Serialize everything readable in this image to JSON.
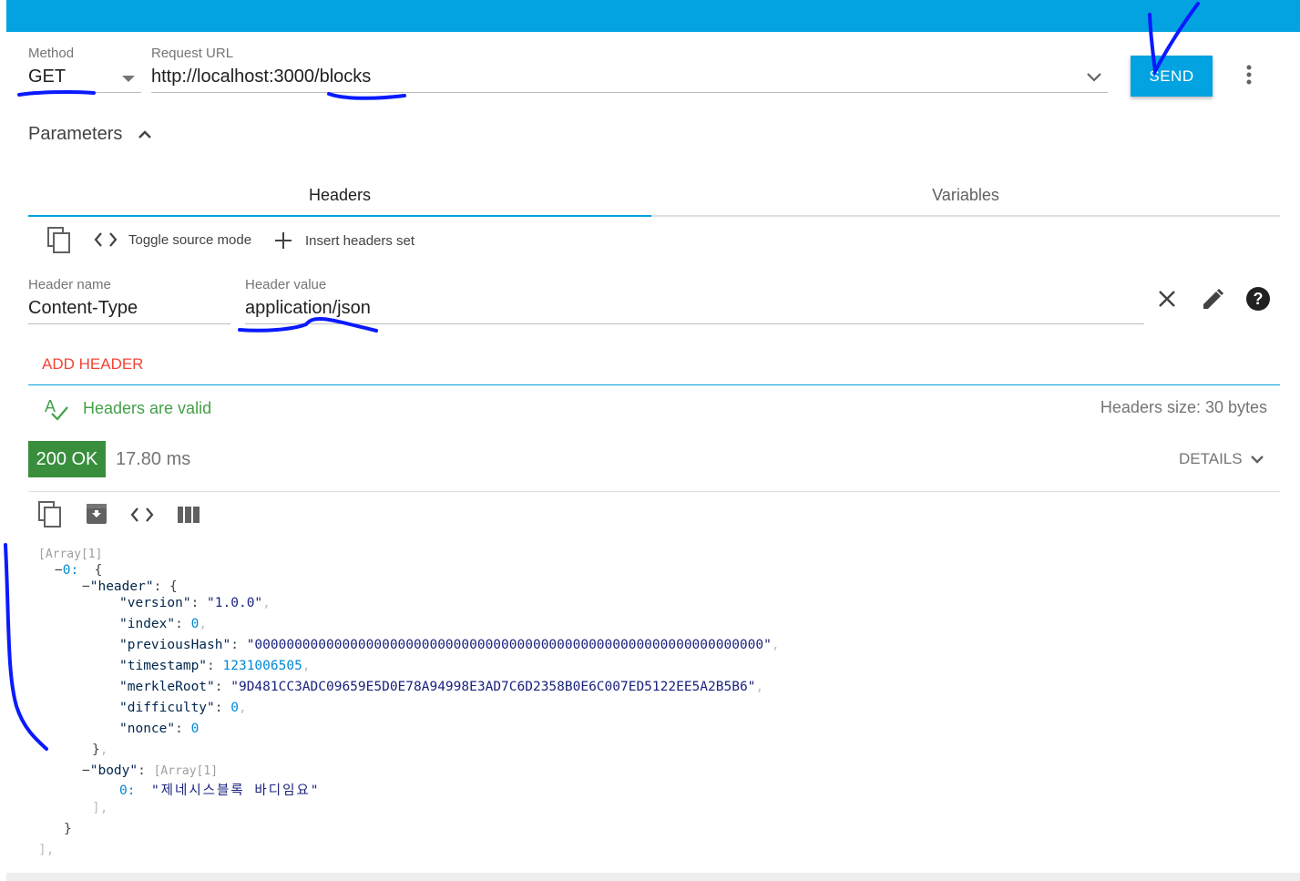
{
  "request": {
    "method_label": "Method",
    "method_value": "GET",
    "url_label": "Request URL",
    "url_value": "http://localhost:3000/blocks",
    "send_label": "SEND"
  },
  "parameters": {
    "title": "Parameters"
  },
  "tabs": [
    {
      "label": "Headers",
      "active": true
    },
    {
      "label": "Variables",
      "active": false
    }
  ],
  "toolbar": {
    "toggle_source": "Toggle source mode",
    "insert_headers": "Insert headers set"
  },
  "header_row": {
    "name_label": "Header name",
    "name_value": "Content-Type",
    "value_label": "Header value",
    "value_value": "application/json"
  },
  "add_header": "ADD HEADER",
  "validation": {
    "valid_text": "Headers are valid",
    "size_text": "Headers size: 30 bytes"
  },
  "response": {
    "status": "200 OK",
    "time": "17.80 ms",
    "details": "DETAILS"
  },
  "json": {
    "root_tag": "[Array[1]",
    "idx0": "0:",
    "k_header": "\"header\"",
    "k_version": "\"version\"",
    "v_version": "\"1.0.0\"",
    "k_index": "\"index\"",
    "v_index": "0",
    "k_prev": "\"previousHash\"",
    "v_prev": "\"0000000000000000000000000000000000000000000000000000000000000000\"",
    "k_ts": "\"timestamp\"",
    "v_ts": "1231006505",
    "k_merkle": "\"merkleRoot\"",
    "v_merkle": "\"9D481CC3ADC09659E5D0E78A94998E3AD7C6D2358B0E6C007ED5122EE5A2B5B6\"",
    "k_diff": "\"difficulty\"",
    "v_diff": "0",
    "k_nonce": "\"nonce\"",
    "v_nonce": "0",
    "k_body": "\"body\"",
    "body_tag": "[Array[1]",
    "body0_idx": "0:",
    "body0_val": "\"제네시스블록 바디임요\""
  },
  "colors": {
    "accent": "#03a2e0",
    "error": "#f44336",
    "success": "#43a047",
    "status_bg": "#388e3c"
  }
}
